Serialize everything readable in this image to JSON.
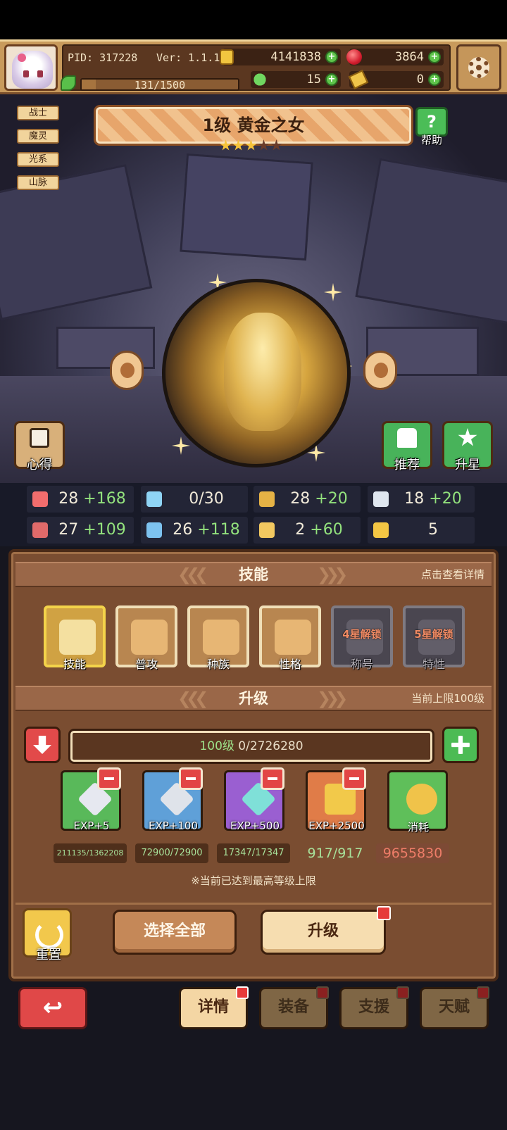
{
  "hud": {
    "pid": "PID: 317228",
    "version": "Ver: 1.1.1.2",
    "gold": "4141838",
    "gems": "3864",
    "exp_bar": "131/1500",
    "clover": "15",
    "ticket": "0"
  },
  "tags": [
    "战士",
    "魔灵",
    "光系",
    "山脉"
  ],
  "hero": {
    "title": "1级  黄金之女",
    "stars_on": 3,
    "stars_total": 5,
    "help_label": "帮助"
  },
  "scene_buttons": {
    "notes": "心得",
    "recommend": "推荐",
    "star_up": "升星"
  },
  "stats": [
    {
      "icon": "heart-icon",
      "color": "#f26d6d",
      "base": "28",
      "bonus": "+168"
    },
    {
      "icon": "water-drop-icon",
      "color": "#8fd4f5",
      "base": "0/30",
      "bonus": ""
    },
    {
      "icon": "shield-icon",
      "color": "#e5b245",
      "base": "28",
      "bonus": "+20"
    },
    {
      "icon": "wing-icon",
      "color": "#dfe6ef",
      "base": "18",
      "bonus": "+20"
    },
    {
      "icon": "fist-icon",
      "color": "#e06a6a",
      "base": "27",
      "bonus": "+109"
    },
    {
      "icon": "book-icon",
      "color": "#7dc2ef",
      "base": "26",
      "bonus": "+118"
    },
    {
      "icon": "boot-icon",
      "color": "#f2c860",
      "base": "2",
      "bonus": "+60"
    },
    {
      "icon": "horseshoe-icon",
      "color": "#f3c644",
      "base": "5",
      "bonus": ""
    }
  ],
  "skills_section": {
    "title": "技能",
    "hint": "点击查看详情",
    "items": [
      {
        "label": "技能",
        "lock": ""
      },
      {
        "label": "普攻",
        "lock": ""
      },
      {
        "label": "种族",
        "lock": ""
      },
      {
        "label": "性格",
        "lock": ""
      },
      {
        "label": "称号",
        "lock": "4星解锁"
      },
      {
        "label": "特性",
        "lock": "5星解锁"
      }
    ]
  },
  "upgrade_section": {
    "title": "升级",
    "hint": "当前上限100级",
    "level_prefix": "100级",
    "level_exp": " 0/2726280",
    "items": [
      {
        "label": "EXP+5",
        "count": "211135/1362208",
        "color": "#59b95a"
      },
      {
        "label": "EXP+100",
        "count": "72900/72900",
        "color": "#5fa0d8"
      },
      {
        "label": "EXP+500",
        "count": "17347/17347",
        "color": "#9a5fd1"
      },
      {
        "label": "EXP+2500",
        "count": "917/917",
        "color": "#e07c48"
      },
      {
        "label": "消耗",
        "count": "9655830",
        "color": "#5fbf5a"
      }
    ],
    "note": "※当前已达到最高等级上限"
  },
  "actions": {
    "reset": "重置",
    "select_all": "选择全部",
    "upgrade": "升级"
  },
  "nav": {
    "tabs": [
      "详情",
      "装备",
      "支援",
      "天赋"
    ]
  }
}
